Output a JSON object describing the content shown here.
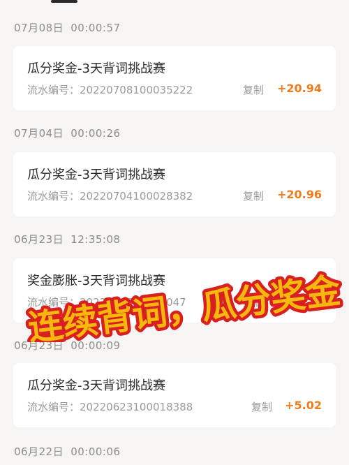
{
  "records": [
    {
      "date": "07月08日",
      "time": "00:00:57",
      "title": "瓜分奖金-3天背词挑战赛",
      "serial_label": "流水编号：",
      "serial": "20220708100035222",
      "copy_label": "复制",
      "amount": "+20.94"
    },
    {
      "date": "07月04日",
      "time": "00:00:26",
      "title": "瓜分奖金-3天背词挑战赛",
      "serial_label": "流水编号：",
      "serial": "20220704100028382",
      "copy_label": "复制",
      "amount": "+20.96"
    },
    {
      "date": "06月23日",
      "time": "12:35:08",
      "title": "奖金膨胀-3天背词挑战赛",
      "serial_label": "流水编号：",
      "serial": "2022062310013047",
      "copy_label": "复制",
      "amount": ""
    },
    {
      "date": "06月23日",
      "time": "00:00:09",
      "title": "瓜分奖金-3天背词挑战赛",
      "serial_label": "流水编号：",
      "serial": "20220623100018388",
      "copy_label": "复制",
      "amount": "+5.02"
    },
    {
      "date": "06月22日",
      "time": "00:00:06"
    }
  ],
  "overlay": {
    "text": "连续背词，瓜分奖金",
    "fill_color": "#f7b80d",
    "stroke_color": "#d91f1f"
  },
  "colors": {
    "amount": "#f07c1c",
    "background": "#f6f5f3"
  }
}
